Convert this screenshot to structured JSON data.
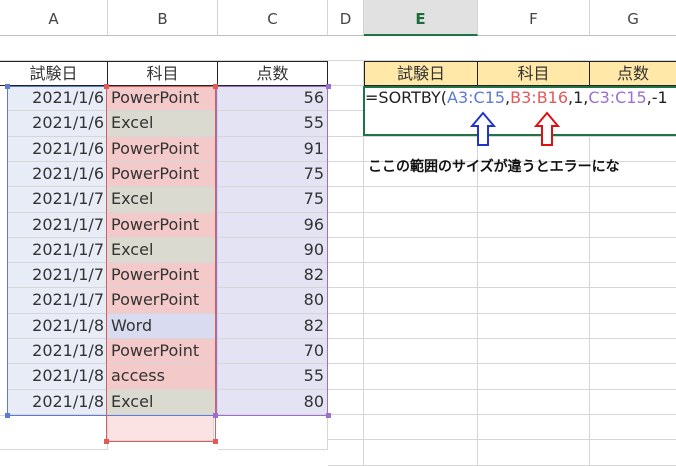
{
  "columns": [
    "A",
    "B",
    "C",
    "D",
    "E",
    "F",
    "G"
  ],
  "headers": {
    "date": "試験日",
    "subject": "科目",
    "score": "点数"
  },
  "rows": [
    {
      "date": "2021/1/6",
      "subject": "PowerPoint",
      "score": "56"
    },
    {
      "date": "2021/1/6",
      "subject": "Excel",
      "score": "55"
    },
    {
      "date": "2021/1/6",
      "subject": "PowerPoint",
      "score": "91"
    },
    {
      "date": "2021/1/6",
      "subject": "PowerPoint",
      "score": "75"
    },
    {
      "date": "2021/1/7",
      "subject": "Excel",
      "score": "75"
    },
    {
      "date": "2021/1/7",
      "subject": "PowerPoint",
      "score": "96"
    },
    {
      "date": "2021/1/7",
      "subject": "Excel",
      "score": "90"
    },
    {
      "date": "2021/1/7",
      "subject": "PowerPoint",
      "score": "82"
    },
    {
      "date": "2021/1/7",
      "subject": "PowerPoint",
      "score": "80"
    },
    {
      "date": "2021/1/8",
      "subject": "Word",
      "score": "82"
    },
    {
      "date": "2021/1/8",
      "subject": "PowerPoint",
      "score": "70"
    },
    {
      "date": "2021/1/8",
      "subject": "access",
      "score": "55"
    },
    {
      "date": "2021/1/8",
      "subject": "Excel",
      "score": "80"
    }
  ],
  "formula": {
    "prefix": "=SORTBY(",
    "range1": "A3:C15",
    "sep1": ",",
    "range2": "B3:B16",
    "mid": ",1,",
    "range3": "C3:C15",
    "suffix": ",-1"
  },
  "note": "ここの範囲のサイズが違うとエラーにな",
  "colors": {
    "range1": "#5b7bd5",
    "range2": "#e05a5a",
    "range3": "#9b6fcf",
    "header_fill": "#ffe8a8",
    "selected_col": "#217346"
  }
}
